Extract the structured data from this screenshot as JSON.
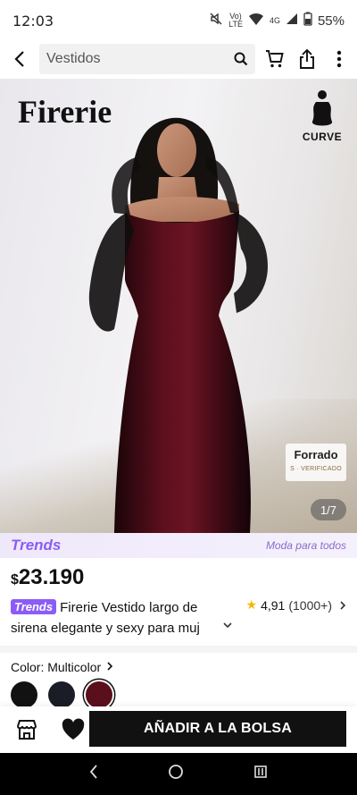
{
  "status_bar": {
    "time": "12:03",
    "volte_label": "Vo)\nLTE",
    "network_label": "4G",
    "battery": "55%"
  },
  "search": {
    "query": "Vestidos"
  },
  "gallery": {
    "brand_overlay": "Firerie",
    "curve_label": "CURVE",
    "lined_label": "Forrado",
    "verified_label": "S · VERIFICADO",
    "counter": "1/7"
  },
  "trends_strip": {
    "logo": "Trends",
    "tagline": "Moda para todos"
  },
  "product": {
    "currency": "$",
    "price": "23.190",
    "trends_pill": "Trends",
    "title": "Firerie Vestido largo de sirena elegante y sexy para muj",
    "rating": "4,91",
    "review_count": "(1000+)"
  },
  "color": {
    "label": "Color: Multicolor",
    "swatches": [
      "#121212",
      "#1a1d26",
      "#5a0f1c"
    ]
  },
  "actions": {
    "add_to_bag": "AÑADIR A LA BOLSA"
  },
  "colors": {
    "accent_purple": "#8b5cf6",
    "dress_red": "#5a0f1c"
  }
}
